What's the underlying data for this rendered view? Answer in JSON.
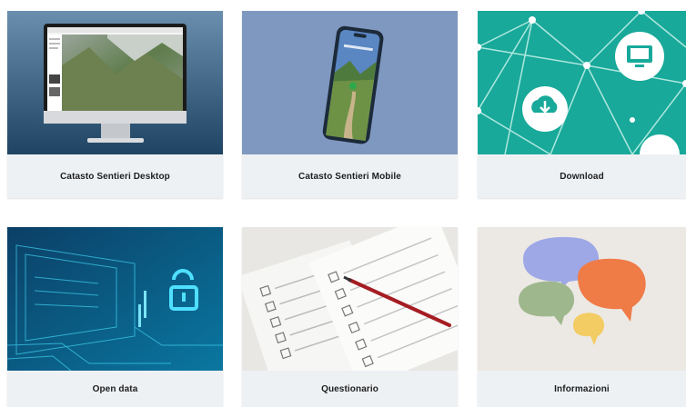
{
  "cards": [
    {
      "label": "Catasto Sentieri Desktop",
      "image": "desktop-monitor-map"
    },
    {
      "label": "Catasto Sentieri Mobile",
      "image": "smartphone-trail"
    },
    {
      "label": "Download",
      "image": "network-download-icon"
    },
    {
      "label": "Open data",
      "image": "unlocked-padlock-circuit"
    },
    {
      "label": "Questionario",
      "image": "survey-checkboxes-pen"
    },
    {
      "label": "Informazioni",
      "image": "speech-bubbles"
    }
  ],
  "colors": {
    "card_bg": "#eef1f4",
    "download_teal": "#18a99a",
    "opendata_blue": "#0a4f78",
    "desktop_blue": "#3d6b8e",
    "mobile_blue": "#7f98c0"
  }
}
